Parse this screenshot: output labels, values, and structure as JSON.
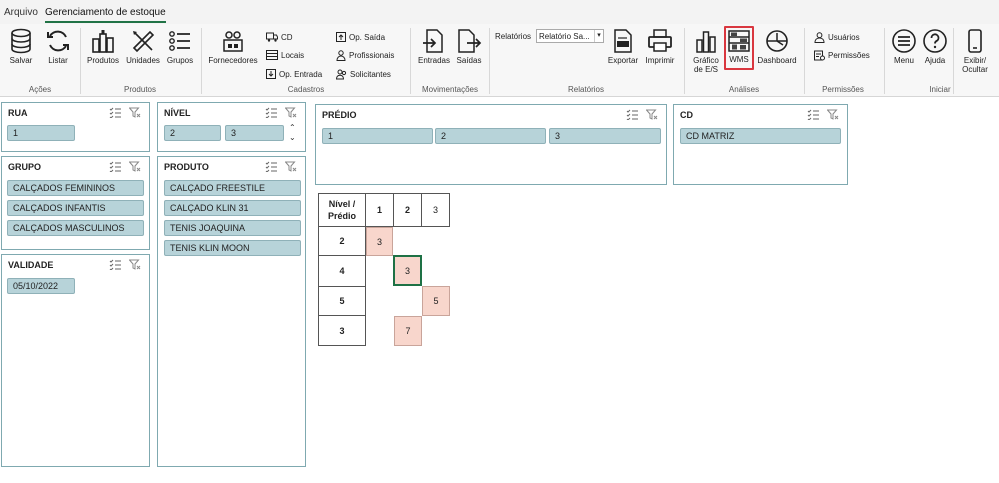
{
  "tabs": [
    "Arquivo",
    "Gerenciamento de estoque"
  ],
  "ribbon": {
    "acoes": {
      "label": "Ações",
      "salvar": "Salvar",
      "listar": "Listar"
    },
    "produtos": {
      "label": "Produtos",
      "produtos": "Produtos",
      "unidades": "Unidades",
      "grupos": "Grupos"
    },
    "cadastros": {
      "label": "Cadastros",
      "fornecedores": "Fornecedores",
      "cd": "CD",
      "locais": "Locais",
      "op_entrada": "Op. Entrada",
      "op_saida": "Op. Saída",
      "profissionais": "Profissionais",
      "solicitantes": "Solicitantes"
    },
    "movimentacoes": {
      "label": "Movimentações",
      "entradas": "Entradas",
      "saidas": "Saídas"
    },
    "relatorios": {
      "label": "Relatórios",
      "combo_label": "Relatórios",
      "combo_value": "Relatório Sa...",
      "exportar": "Exportar",
      "imprimir": "Imprimir"
    },
    "analises": {
      "label": "Análises",
      "grafico": "Gráfico",
      "grafico2": "de E/S",
      "wms": "WMS",
      "dashboard": "Dashboard"
    },
    "permissoes": {
      "label": "Permissões",
      "usuarios": "Usuários",
      "permissoes": "Permissões"
    },
    "iniciar": {
      "label": "Iniciar",
      "menu": "Menu",
      "ajuda": "Ajuda",
      "exibir": "Exibir/",
      "ocultar": "Ocultar"
    }
  },
  "slicers": {
    "rua": {
      "title": "RUA",
      "items": [
        "1"
      ]
    },
    "grupo": {
      "title": "GRUPO",
      "items": [
        "CALÇADOS FEMININOS",
        "CALÇADOS INFANTIS",
        "CALÇADOS MASCULINOS"
      ]
    },
    "validade": {
      "title": "VALIDADE",
      "items": [
        "05/10/2022"
      ]
    },
    "nivel": {
      "title": "NÍVEL",
      "items": [
        "2",
        "3"
      ]
    },
    "produto": {
      "title": "PRODUTO",
      "items": [
        "CALÇADO FREESTILE",
        "CALÇADO KLIN 31",
        "TENIS JOAQUINA",
        "TENIS KLIN MOON"
      ]
    },
    "predio": {
      "title": "PRÉDIO",
      "items": [
        "1",
        "2",
        "3"
      ]
    },
    "cd": {
      "title": "CD",
      "items": [
        "CD MATRIZ"
      ]
    }
  },
  "pivot": {
    "corner_line1": "Nível /",
    "corner_line2": "Prédio",
    "cols": [
      "1",
      "2",
      "3"
    ],
    "rows": [
      {
        "label": "2",
        "values": [
          "3",
          "",
          ""
        ]
      },
      {
        "label": "4",
        "values": [
          "",
          "3",
          ""
        ]
      },
      {
        "label": "5",
        "values": [
          "",
          "",
          "5"
        ]
      },
      {
        "label": "3",
        "values": [
          "",
          "7",
          ""
        ]
      }
    ]
  },
  "colors": {
    "accent": "#217346",
    "slicer_item": "#b7d3d9",
    "heat": "#f8d6cc",
    "highlight": "#d9373f"
  }
}
